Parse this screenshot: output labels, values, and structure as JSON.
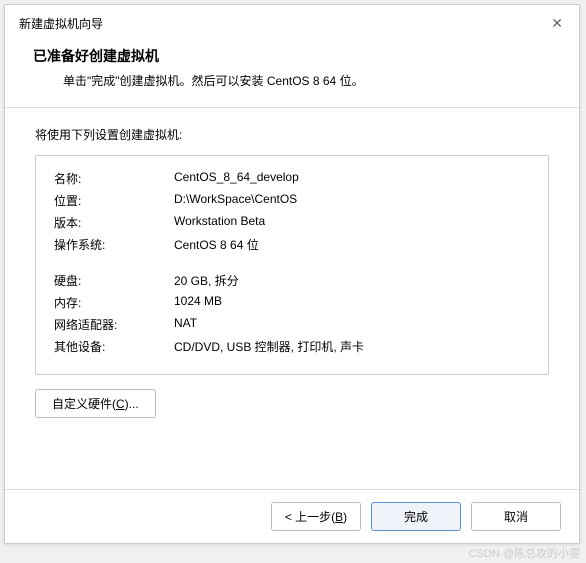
{
  "window": {
    "title": "新建虚拟机向导",
    "close": "✕"
  },
  "header": {
    "title": "已准备好创建虚拟机",
    "subtitle": "单击\"完成\"创建虚拟机。然后可以安装 CentOS 8 64 位。"
  },
  "content": {
    "label": "将使用下列设置创建虚拟机:"
  },
  "settings": {
    "group1": [
      {
        "key": "名称:",
        "val": "CentOS_8_64_develop"
      },
      {
        "key": "位置:",
        "val": "D:\\WorkSpace\\CentOS"
      },
      {
        "key": "版本:",
        "val": "Workstation Beta"
      },
      {
        "key": "操作系统:",
        "val": "CentOS 8 64 位"
      }
    ],
    "group2": [
      {
        "key": "硬盘:",
        "val": "20 GB, 拆分"
      },
      {
        "key": "内存:",
        "val": "1024 MB"
      },
      {
        "key": "网络适配器:",
        "val": "NAT"
      },
      {
        "key": "其他设备:",
        "val": "CD/DVD, USB 控制器, 打印机, 声卡"
      }
    ]
  },
  "buttons": {
    "customize_prefix": "自定义硬件(",
    "customize_key": "C",
    "customize_suffix": ")...",
    "back_prefix": "< 上一步(",
    "back_key": "B",
    "back_suffix": ")",
    "finish": "完成",
    "cancel": "取消"
  },
  "watermark": "CSDN @陈总攻的小雯"
}
